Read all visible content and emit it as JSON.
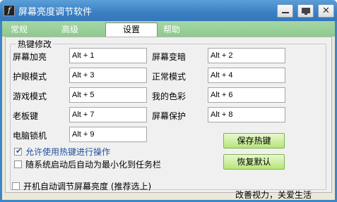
{
  "window": {
    "title": "屏幕亮度调节软件",
    "app_icon_glyph": "f"
  },
  "tabs": [
    {
      "label": "常规",
      "active": false
    },
    {
      "label": "高级",
      "active": false
    },
    {
      "label": "设置",
      "active": true
    },
    {
      "label": "帮助",
      "active": false
    }
  ],
  "hotkeys": {
    "group_title": "热键修改",
    "items": [
      {
        "label": "屏幕加亮",
        "value": "Alt + 1"
      },
      {
        "label": "屏幕变暗",
        "value": "Alt + 2"
      },
      {
        "label": "护眼模式",
        "value": "Alt + 3"
      },
      {
        "label": "正常模式",
        "value": "Alt + 4"
      },
      {
        "label": "游戏模式",
        "value": "Alt + 5"
      },
      {
        "label": "我的色彩",
        "value": "Alt + 6"
      },
      {
        "label": "老板键",
        "value": "Alt + 7"
      },
      {
        "label": "屏幕保护",
        "value": "Alt + 8"
      },
      {
        "label": "电脑锁机",
        "value": "Alt + 9"
      }
    ],
    "save_label": "保存热键",
    "restore_label": "恢复默认",
    "enable_hotkeys": {
      "label": "允许使用热键进行操作",
      "checked": true
    },
    "minimize_on_start": {
      "label": "随系统启动后自动为最小化到任务栏",
      "checked": false
    }
  },
  "footer": {
    "autostart": {
      "label": "开机自动调节屏幕亮度 (推荐选上)",
      "checked": false
    },
    "slogan": "改善视力，关爱生活"
  },
  "colors": {
    "titlebar": "#3a7fc2",
    "tabstrip": "#8ec98e",
    "button": "#b6e57a"
  }
}
